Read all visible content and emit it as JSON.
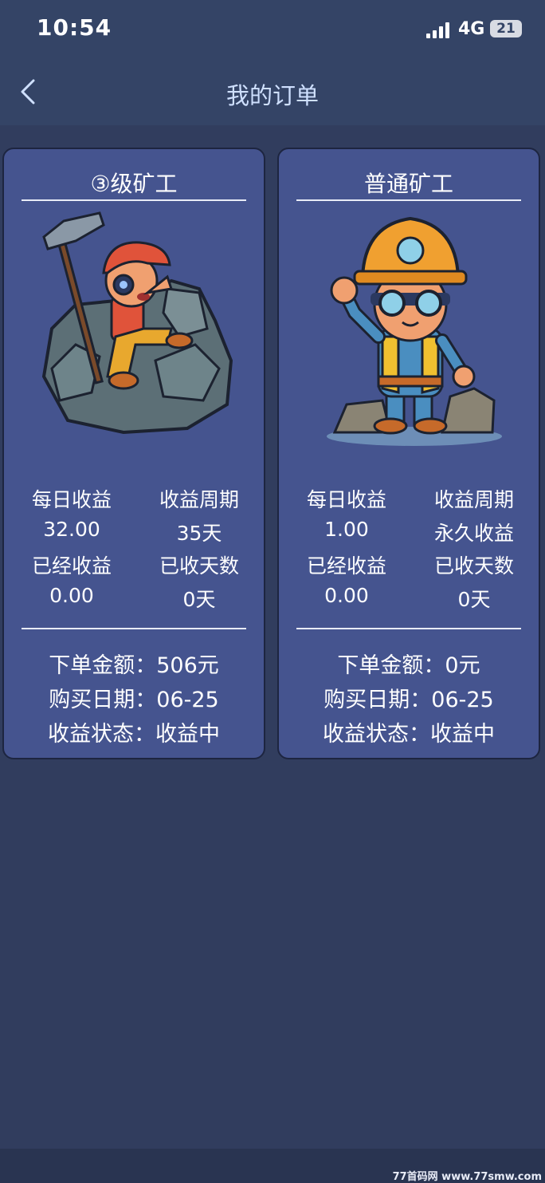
{
  "status_bar": {
    "time": "10:54",
    "network": "4G",
    "battery": "21"
  },
  "header": {
    "title": "我的订单",
    "back_icon": "chevron-left-icon"
  },
  "orders": [
    {
      "title": "③级矿工",
      "image": "miner-with-pickaxe-illustration",
      "daily_income_label": "每日收益",
      "daily_income_value": "32.00",
      "cycle_label": "收益周期",
      "cycle_value": "35天",
      "earned_label": "已经收益",
      "earned_value": "0.00",
      "days_label": "已收天数",
      "days_value": "0天",
      "amount_line": "下单金额：506元",
      "date_line": "购买日期：06-25",
      "status_line": "收益状态：收益中"
    },
    {
      "title": "普通矿工",
      "image": "miner-with-helmet-illustration",
      "daily_income_label": "每日收益",
      "daily_income_value": "1.00",
      "cycle_label": "收益周期",
      "cycle_value": "永久收益",
      "earned_label": "已经收益",
      "earned_value": "0.00",
      "days_label": "已收天数",
      "days_value": "0天",
      "amount_line": "下单金额：0元",
      "date_line": "购买日期：06-25",
      "status_line": "收益状态：收益中"
    }
  ],
  "watermark": "77首码网 www.77smw.com",
  "colors": {
    "background": "#313d5e",
    "header": "#344466",
    "card": "#45548f",
    "title_text": "#cfe0ff"
  }
}
